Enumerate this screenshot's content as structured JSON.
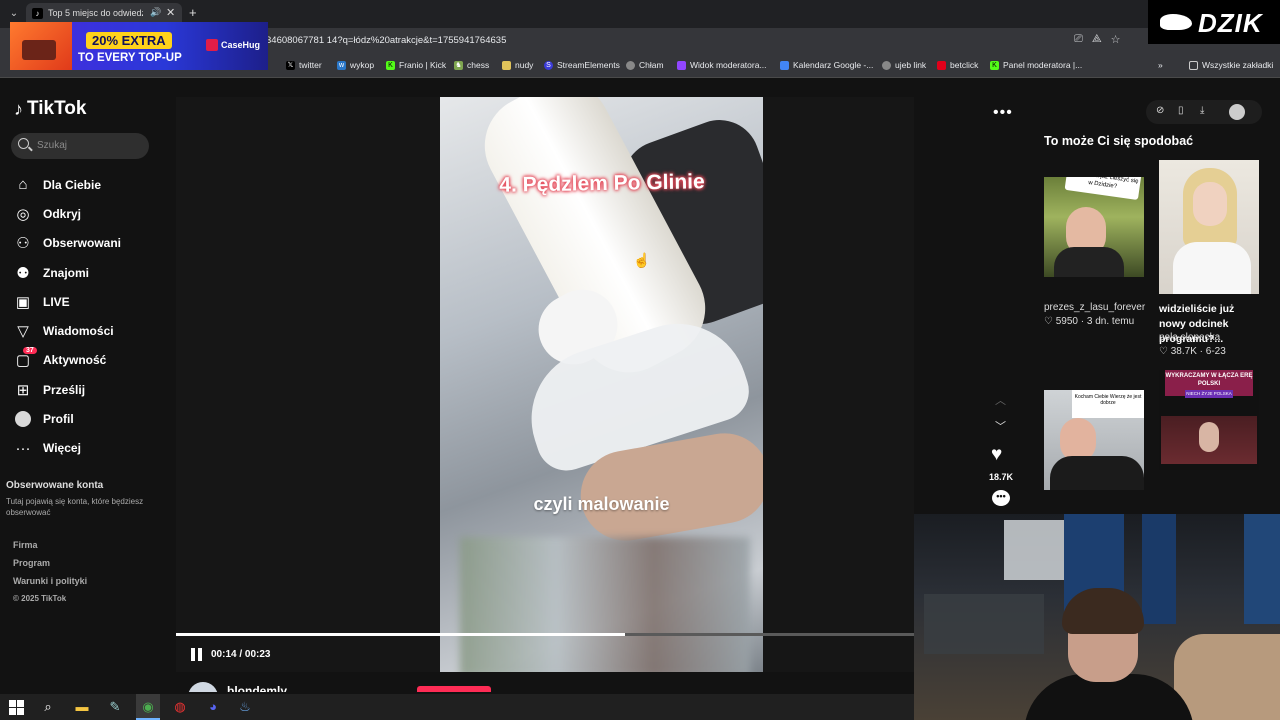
{
  "browser": {
    "tab_title": "Top 5 miejsc do odwiedzeni",
    "url": "34608067781 14?q=łódz%20atrakcje&t=1755941764635",
    "bookmarks": [
      {
        "label": "jtwitter",
        "icon": "x-icon",
        "color": "#000000"
      },
      {
        "label": "twitter",
        "icon": "x-icon",
        "color": "#000000"
      },
      {
        "label": "wykop",
        "icon": "wykop-icon",
        "color": "#2a77c9"
      },
      {
        "label": "Franio | Kick",
        "icon": "kick-icon",
        "color": "#53fc18"
      },
      {
        "label": "chess",
        "icon": "chess-icon",
        "color": "#7fa650"
      },
      {
        "label": "nudy",
        "icon": "folder-icon",
        "color": "#e0c35a"
      },
      {
        "label": "StreamElements",
        "icon": "streamelements-icon",
        "color": "#3b3bd8"
      },
      {
        "label": "Chłam",
        "icon": "globe-icon",
        "color": "#888888"
      },
      {
        "label": "Widok moderatora...",
        "icon": "twitch-icon",
        "color": "#9146ff"
      },
      {
        "label": "Kalendarz Google -...",
        "icon": "calendar-icon",
        "color": "#4285f4"
      },
      {
        "label": "ujeb link",
        "icon": "globe-icon",
        "color": "#888888"
      },
      {
        "label": "betclick",
        "icon": "betclick-icon",
        "color": "#e2001a"
      },
      {
        "label": "Panel moderatora |...",
        "icon": "kick-icon",
        "color": "#53fc18"
      }
    ],
    "all_bookmarks": "Wszystkie zakładki"
  },
  "ad": {
    "line1": "20% EXTRA",
    "line2": "TO EVERY TOP-UP",
    "brand": "CaseHug"
  },
  "overlay": {
    "brand": "DZIK"
  },
  "sidebar": {
    "logo": "TikTok",
    "search_placeholder": "Szukaj",
    "items": [
      {
        "label": "Dla Ciebie",
        "icon": "home-icon"
      },
      {
        "label": "Odkryj",
        "icon": "compass-icon"
      },
      {
        "label": "Obserwowani",
        "icon": "following-icon"
      },
      {
        "label": "Znajomi",
        "icon": "friends-icon"
      },
      {
        "label": "LIVE",
        "icon": "live-icon"
      },
      {
        "label": "Wiadomości",
        "icon": "messages-icon"
      },
      {
        "label": "Aktywność",
        "icon": "activity-icon",
        "badge": "37"
      },
      {
        "label": "Prześlij",
        "icon": "upload-icon"
      },
      {
        "label": "Profil",
        "icon": "profile-avatar-icon"
      },
      {
        "label": "Więcej",
        "icon": "more-icon"
      }
    ],
    "followed_title": "Obserwowane konta",
    "followed_desc": "Tutaj pojawią się konta, które będziesz obserwować",
    "footer": [
      "Firma",
      "Program",
      "Warunki i polityki"
    ],
    "copyright": "© 2025 TikTok"
  },
  "video": {
    "caption_top": "4. Pędzlem Po Glinie",
    "caption_bottom": "czyli malowanie",
    "time": "00:14 / 00:23",
    "progress": 0.6087,
    "likes": "18.7K",
    "author": "blondemly"
  },
  "recommendations": {
    "title": "To może Ci się spodobać",
    "items": [
      {
        "author": "prezes_z_lasu_forever",
        "likes": "5950",
        "age": "3 dn. temu",
        "bubble": "Czy można już cieszyć się w Dzidzie?"
      },
      {
        "title": "widzieliście już nowy odcinek programu?...",
        "author": "pola.slopecka",
        "likes": "38.7K",
        "age": "6-23"
      },
      {
        "card": "Kocham Ciebie Wierzę że jest dobrze"
      },
      {
        "banner": "WYKRACZAMY W ŁĄCZA ERĘ POLSKI",
        "banner2": "NIECH ŻYJE POLSKA"
      }
    ]
  }
}
